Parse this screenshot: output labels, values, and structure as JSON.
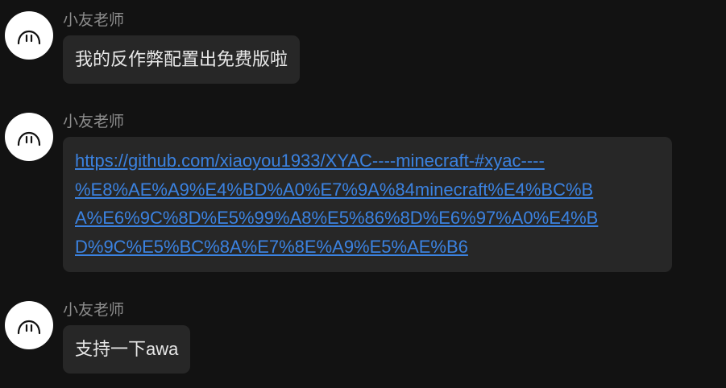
{
  "messages": [
    {
      "sender": "小友老师",
      "text": "我的反作弊配置出免费版啦"
    },
    {
      "sender": "小友老师",
      "link_lines": [
        "https://github.com/xiaoyou1933/XYAC----minecraft-#xyac----",
        "%E8%AE%A9%E4%BD%A0%E7%9A%84minecraft%E4%BC%B",
        "A%E6%9C%8D%E5%99%A8%E5%86%8D%E6%97%A0%E4%B",
        "D%9C%E5%BC%8A%E7%8E%A9%E5%AE%B6"
      ]
    },
    {
      "sender": "小友老师",
      "text": "支持一下awa"
    }
  ],
  "colors": {
    "background": "#121212",
    "bubble": "#272727",
    "sender_name": "#8c8c8c",
    "message_text": "#e8e8e8",
    "link": "#3b82e0",
    "avatar": "#ffffff"
  },
  "icons": {
    "avatar": "ghost-face-icon"
  }
}
